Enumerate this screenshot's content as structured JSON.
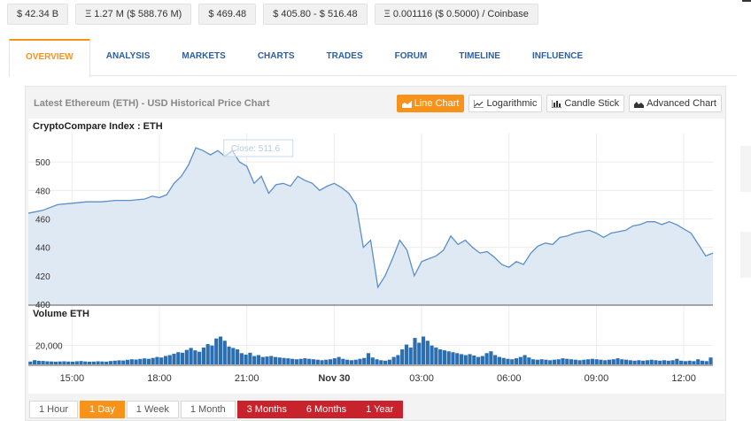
{
  "stats": [
    "$ 42.34 B",
    "Ξ 1.27 M ($ 588.76 M)",
    "$ 469.48",
    "$ 405.80 - $ 516.48",
    "Ξ 0.001116 ($ 0.5000) / Coinbase"
  ],
  "tabs": [
    "OVERVIEW",
    "ANALYSIS",
    "MARKETS",
    "CHARTS",
    "TRADES",
    "FORUM",
    "TIMELINE",
    "INFLUENCE"
  ],
  "active_tab": "OVERVIEW",
  "panel": {
    "title": "Latest Ethereum (ETH) - USD Historical Price Chart",
    "chart_buttons": [
      "Line Chart",
      "Logarithmic",
      "Candle Stick",
      "Advanced Chart"
    ],
    "active_chart_button": "Line Chart",
    "index_label": "CryptoCompare Index : ETH",
    "volume_label": "Volume ETH",
    "tooltip": "Close: 511.6"
  },
  "ranges": [
    "1 Hour",
    "1 Day",
    "1 Week",
    "1 Month",
    "3 Months",
    "6 Months",
    "1 Year"
  ],
  "selected_range": "1 Day",
  "colors": {
    "accent": "#f7931a",
    "link": "#2d5fa0",
    "line": "#5b8fc9",
    "area": "#dfe9f4",
    "volume": "#2c6fb0",
    "range_red": "#c8232c"
  },
  "chart_data": [
    {
      "type": "area",
      "title": "CryptoCompare Index : ETH",
      "x_ticks": [
        "15:00",
        "18:00",
        "21:00",
        "Nov 30",
        "03:00",
        "06:00",
        "09:00",
        "12:00"
      ],
      "y_ticks": [
        400,
        420,
        440,
        460,
        480,
        500
      ],
      "ylim": [
        400,
        520
      ],
      "x_hours": [
        13.5,
        14.0,
        14.5,
        15.0,
        15.5,
        16.0,
        16.5,
        17.0,
        17.5,
        17.75,
        18.0,
        18.25,
        18.5,
        18.75,
        19.0,
        19.25,
        19.5,
        19.75,
        20.0,
        20.25,
        20.5,
        20.75,
        21.0,
        21.25,
        21.5,
        21.75,
        22.0,
        22.25,
        22.5,
        22.75,
        23.0,
        23.25,
        23.5,
        23.75,
        24.0,
        24.25,
        24.5,
        24.75,
        25.0,
        25.25,
        25.5,
        25.75,
        26.0,
        26.25,
        26.5,
        26.75,
        27.0,
        27.25,
        27.5,
        27.75,
        28.0,
        28.25,
        28.5,
        28.75,
        29.0,
        29.25,
        29.5,
        29.75,
        30.0,
        30.25,
        30.5,
        30.75,
        31.0,
        31.25,
        31.5,
        31.75,
        32.0,
        32.25,
        32.5,
        32.75,
        33.0,
        33.25,
        33.5,
        33.75,
        34.0,
        34.25,
        34.5,
        34.75,
        35.0,
        35.25,
        35.5,
        35.75,
        36.0,
        36.25,
        36.5,
        36.75,
        37.0
      ],
      "close": [
        464,
        466,
        470,
        471,
        472,
        472,
        473,
        473,
        474,
        476,
        475,
        477,
        485,
        490,
        498,
        510,
        508,
        505,
        508,
        504,
        508,
        500,
        497,
        485,
        490,
        478,
        484,
        485,
        483,
        490,
        487,
        485,
        480,
        483,
        485,
        482,
        478,
        470,
        440,
        445,
        412,
        420,
        432,
        445,
        438,
        420,
        430,
        432,
        434,
        438,
        448,
        442,
        445,
        440,
        436,
        437,
        433,
        428,
        426,
        430,
        428,
        436,
        441,
        443,
        442,
        447,
        448,
        450,
        451,
        452,
        450,
        447,
        450,
        451,
        452,
        455,
        456,
        458,
        458,
        456,
        458,
        456,
        453,
        450,
        442,
        434,
        436
      ],
      "tooltip": "Close: 511.6"
    },
    {
      "type": "bar",
      "title": "Volume ETH",
      "y_ticks": [
        20000
      ],
      "ylim": [
        0,
        40000
      ],
      "values": [
        3000,
        4500,
        3800,
        3600,
        3300,
        3100,
        2900,
        3100,
        3300,
        3000,
        2900,
        3300,
        3500,
        3100,
        2800,
        3000,
        3300,
        3100,
        2900,
        3500,
        3900,
        4300,
        4100,
        4800,
        5400,
        5100,
        5800,
        6300,
        5900,
        6800,
        7800,
        7300,
        8800,
        9800,
        11300,
        12800,
        12300,
        15300,
        17300,
        14800,
        13300,
        17800,
        21300,
        19800,
        27300,
        29300,
        24800,
        18800,
        17300,
        15800,
        11800,
        10300,
        12300,
        8800,
        9800,
        7800,
        8300,
        8800,
        7800,
        7300,
        6800,
        6400,
        5900,
        5400,
        5900,
        6400,
        5900,
        5400,
        4900,
        4400,
        4900,
        5400,
        6400,
        7800,
        5900,
        4900,
        4400,
        4900,
        5900,
        6800,
        11800,
        7300,
        5400,
        4400,
        3900,
        4900,
        7800,
        9800,
        15800,
        20800,
        17800,
        27800,
        22800,
        29300,
        24800,
        19800,
        17800,
        15800,
        14800,
        13800,
        12800,
        11800,
        10800,
        9800,
        10800,
        9300,
        7800,
        8800,
        11800,
        13800,
        9800,
        7800,
        6800,
        5900,
        5400,
        6400,
        7800,
        9800,
        7300,
        5400,
        4900,
        5400,
        4900,
        4400,
        4900,
        5400,
        6400,
        5900,
        5400,
        4900,
        4400,
        4900,
        5400,
        5900,
        5400,
        4900,
        4400,
        4900,
        5400,
        6400,
        5400,
        4900,
        4400,
        3900,
        4400,
        3900,
        4400,
        4900,
        4400,
        3900,
        4400,
        3900,
        4400,
        5900,
        3900,
        3400,
        3900,
        3400,
        5400,
        3900,
        3400,
        7300
      ]
    }
  ]
}
